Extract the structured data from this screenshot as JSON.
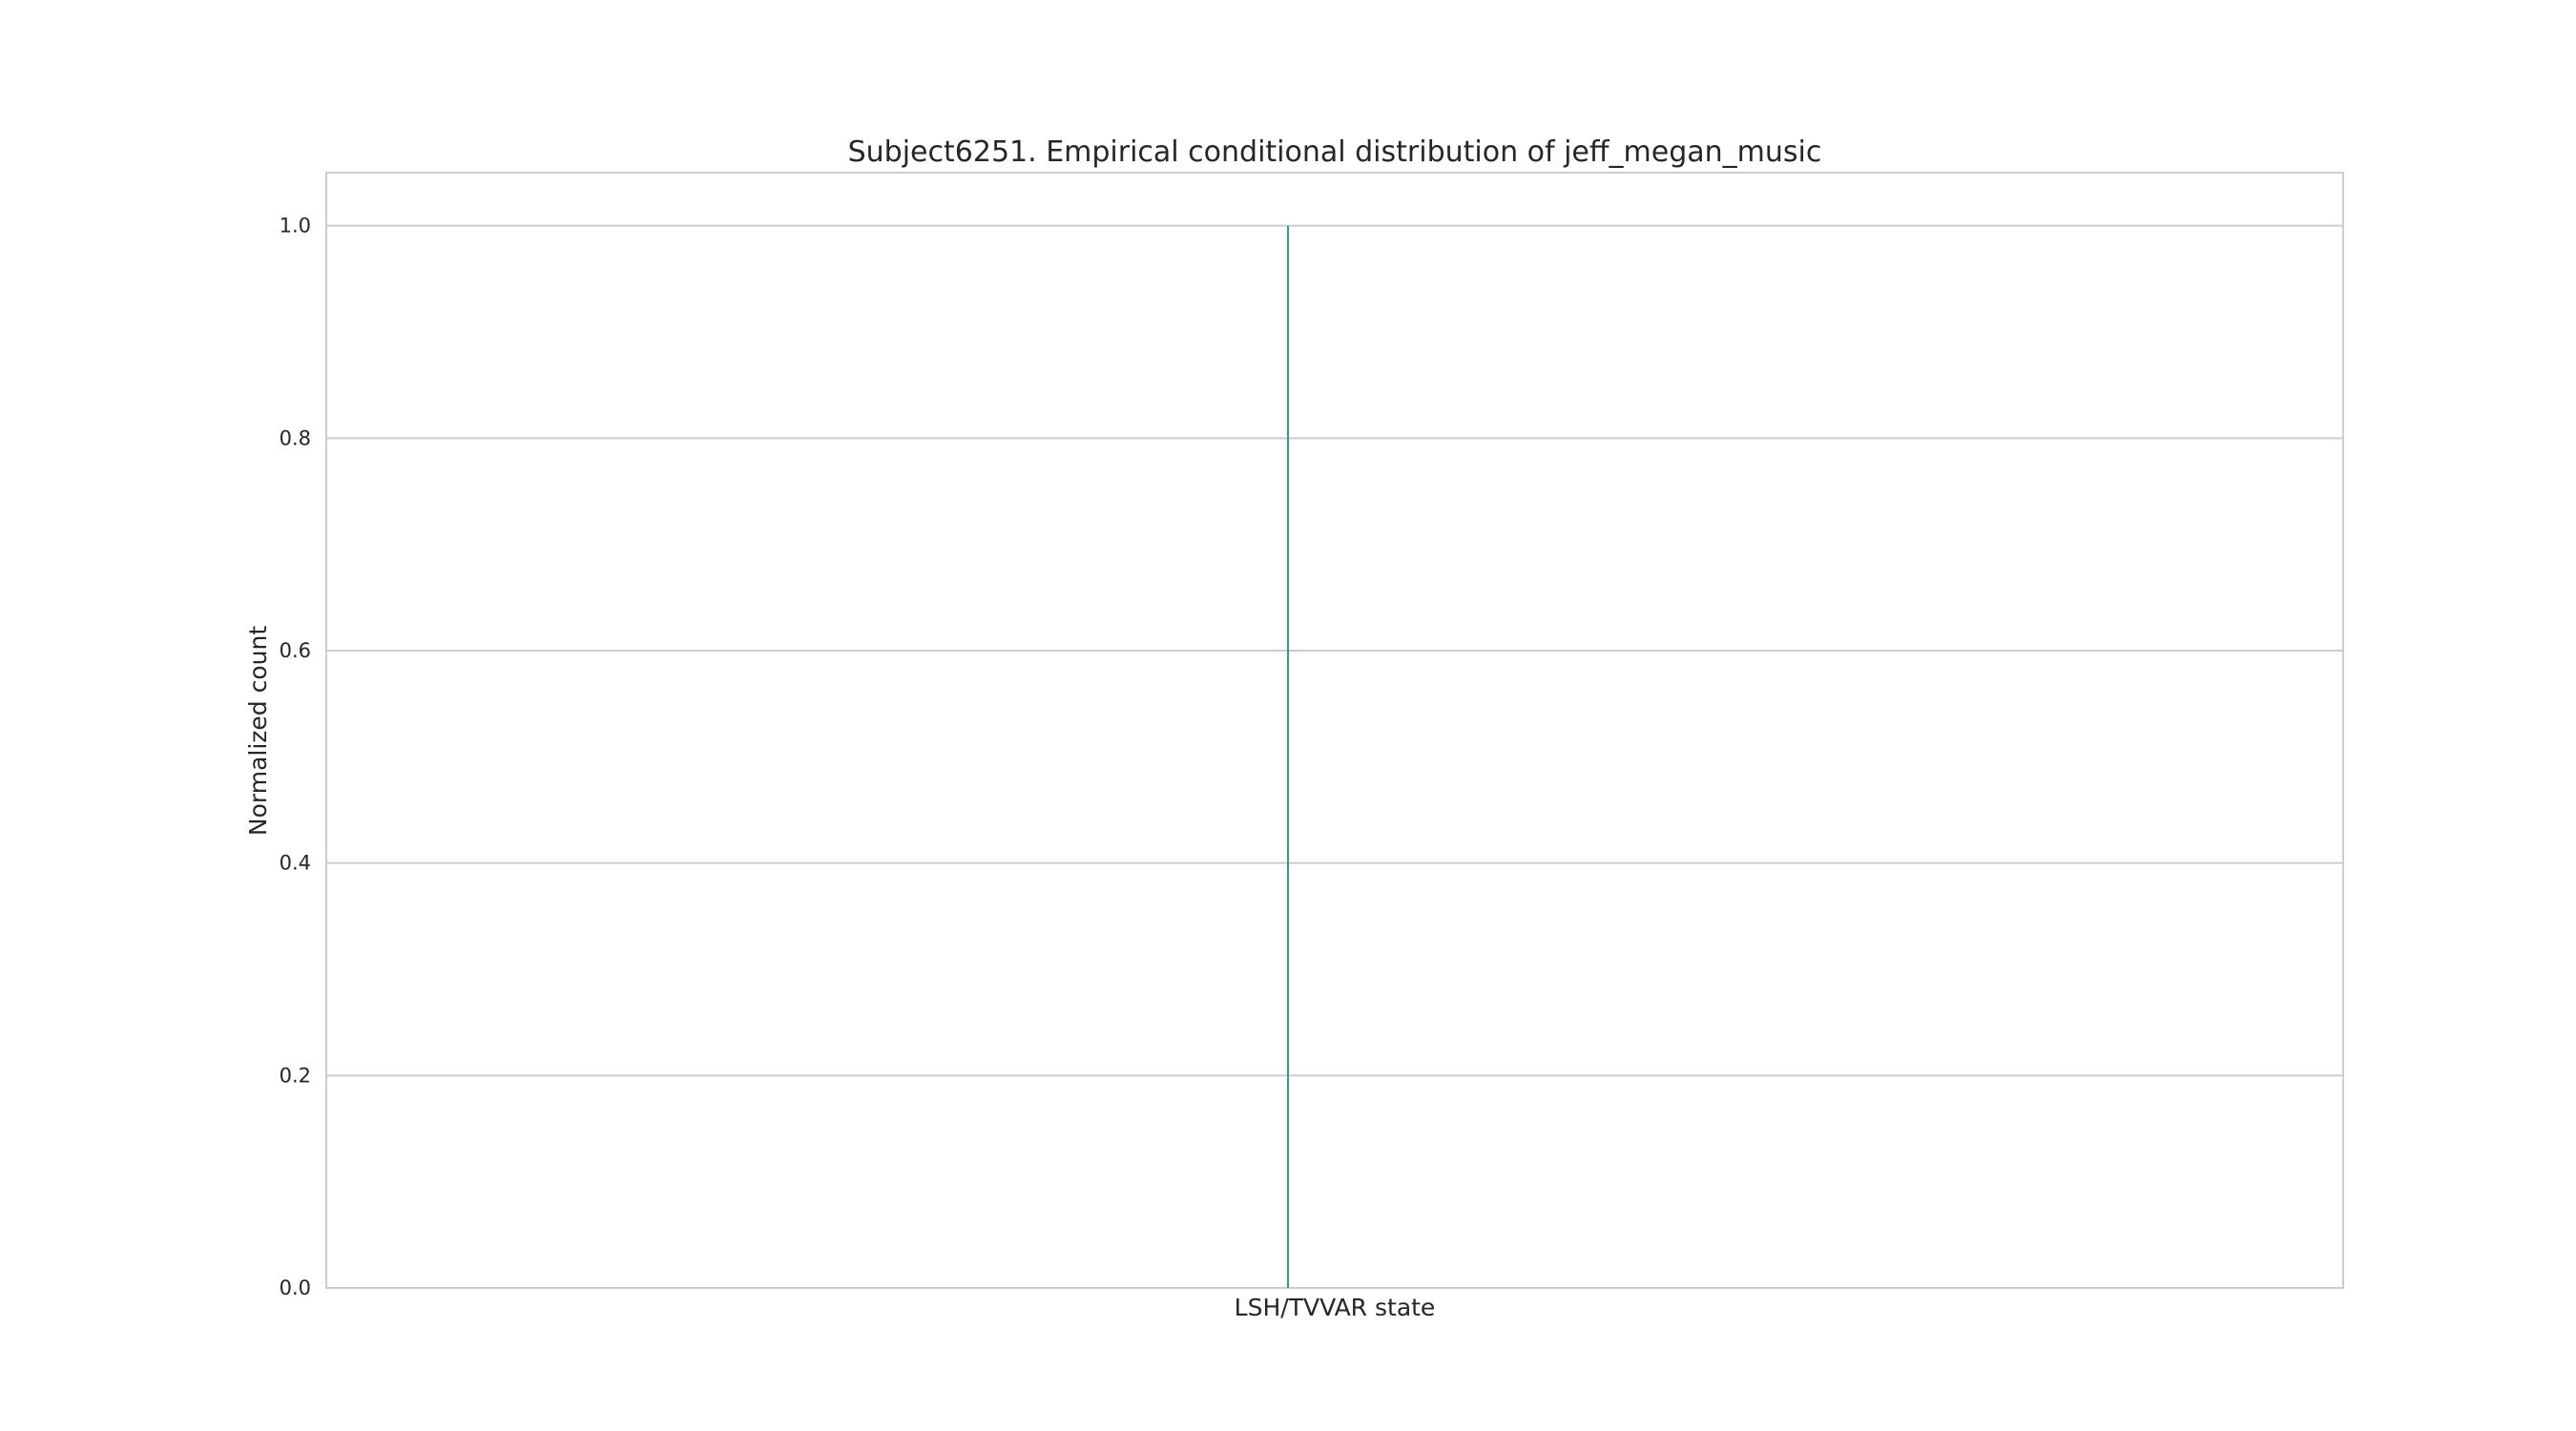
{
  "chart_data": {
    "type": "bar",
    "title": "Subject6251. Empirical conditional distribution of jeff_megan_music",
    "xlabel": "LSH/TVVAR state",
    "ylabel": "Normalized count",
    "ylim": [
      0,
      1.05
    ],
    "yticks": [
      "0.0",
      "0.2",
      "0.4",
      "0.6",
      "0.8",
      "1.0"
    ],
    "ytick_values": [
      0,
      0.2,
      0.4,
      0.6,
      0.8,
      1.0
    ],
    "categories": [
      ""
    ],
    "values": [
      1.0
    ],
    "series_color": "#2a9d8f",
    "grid": true,
    "legend": "none"
  }
}
